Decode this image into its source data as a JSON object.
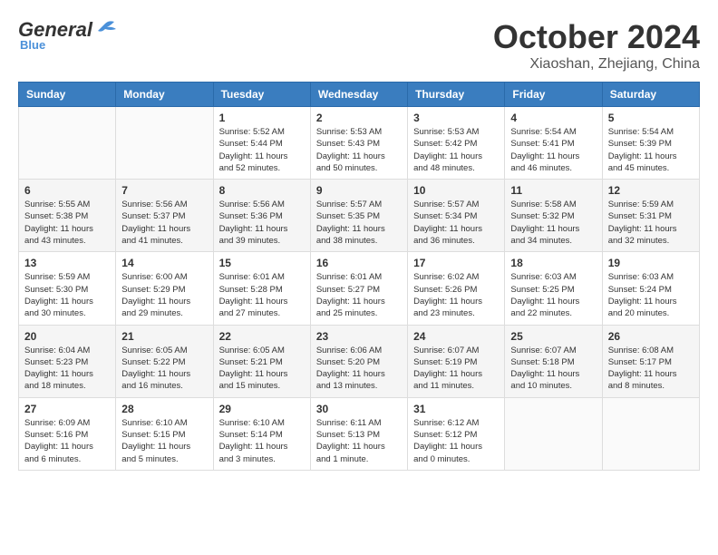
{
  "header": {
    "logo_general": "General",
    "logo_blue": "Blue",
    "month_title": "October 2024",
    "location": "Xiaoshan, Zhejiang, China"
  },
  "columns": [
    "Sunday",
    "Monday",
    "Tuesday",
    "Wednesday",
    "Thursday",
    "Friday",
    "Saturday"
  ],
  "weeks": [
    [
      {
        "day": "",
        "info": ""
      },
      {
        "day": "",
        "info": ""
      },
      {
        "day": "1",
        "info": "Sunrise: 5:52 AM\nSunset: 5:44 PM\nDaylight: 11 hours\nand 52 minutes."
      },
      {
        "day": "2",
        "info": "Sunrise: 5:53 AM\nSunset: 5:43 PM\nDaylight: 11 hours\nand 50 minutes."
      },
      {
        "day": "3",
        "info": "Sunrise: 5:53 AM\nSunset: 5:42 PM\nDaylight: 11 hours\nand 48 minutes."
      },
      {
        "day": "4",
        "info": "Sunrise: 5:54 AM\nSunset: 5:41 PM\nDaylight: 11 hours\nand 46 minutes."
      },
      {
        "day": "5",
        "info": "Sunrise: 5:54 AM\nSunset: 5:39 PM\nDaylight: 11 hours\nand 45 minutes."
      }
    ],
    [
      {
        "day": "6",
        "info": "Sunrise: 5:55 AM\nSunset: 5:38 PM\nDaylight: 11 hours\nand 43 minutes."
      },
      {
        "day": "7",
        "info": "Sunrise: 5:56 AM\nSunset: 5:37 PM\nDaylight: 11 hours\nand 41 minutes."
      },
      {
        "day": "8",
        "info": "Sunrise: 5:56 AM\nSunset: 5:36 PM\nDaylight: 11 hours\nand 39 minutes."
      },
      {
        "day": "9",
        "info": "Sunrise: 5:57 AM\nSunset: 5:35 PM\nDaylight: 11 hours\nand 38 minutes."
      },
      {
        "day": "10",
        "info": "Sunrise: 5:57 AM\nSunset: 5:34 PM\nDaylight: 11 hours\nand 36 minutes."
      },
      {
        "day": "11",
        "info": "Sunrise: 5:58 AM\nSunset: 5:32 PM\nDaylight: 11 hours\nand 34 minutes."
      },
      {
        "day": "12",
        "info": "Sunrise: 5:59 AM\nSunset: 5:31 PM\nDaylight: 11 hours\nand 32 minutes."
      }
    ],
    [
      {
        "day": "13",
        "info": "Sunrise: 5:59 AM\nSunset: 5:30 PM\nDaylight: 11 hours\nand 30 minutes."
      },
      {
        "day": "14",
        "info": "Sunrise: 6:00 AM\nSunset: 5:29 PM\nDaylight: 11 hours\nand 29 minutes."
      },
      {
        "day": "15",
        "info": "Sunrise: 6:01 AM\nSunset: 5:28 PM\nDaylight: 11 hours\nand 27 minutes."
      },
      {
        "day": "16",
        "info": "Sunrise: 6:01 AM\nSunset: 5:27 PM\nDaylight: 11 hours\nand 25 minutes."
      },
      {
        "day": "17",
        "info": "Sunrise: 6:02 AM\nSunset: 5:26 PM\nDaylight: 11 hours\nand 23 minutes."
      },
      {
        "day": "18",
        "info": "Sunrise: 6:03 AM\nSunset: 5:25 PM\nDaylight: 11 hours\nand 22 minutes."
      },
      {
        "day": "19",
        "info": "Sunrise: 6:03 AM\nSunset: 5:24 PM\nDaylight: 11 hours\nand 20 minutes."
      }
    ],
    [
      {
        "day": "20",
        "info": "Sunrise: 6:04 AM\nSunset: 5:23 PM\nDaylight: 11 hours\nand 18 minutes."
      },
      {
        "day": "21",
        "info": "Sunrise: 6:05 AM\nSunset: 5:22 PM\nDaylight: 11 hours\nand 16 minutes."
      },
      {
        "day": "22",
        "info": "Sunrise: 6:05 AM\nSunset: 5:21 PM\nDaylight: 11 hours\nand 15 minutes."
      },
      {
        "day": "23",
        "info": "Sunrise: 6:06 AM\nSunset: 5:20 PM\nDaylight: 11 hours\nand 13 minutes."
      },
      {
        "day": "24",
        "info": "Sunrise: 6:07 AM\nSunset: 5:19 PM\nDaylight: 11 hours\nand 11 minutes."
      },
      {
        "day": "25",
        "info": "Sunrise: 6:07 AM\nSunset: 5:18 PM\nDaylight: 11 hours\nand 10 minutes."
      },
      {
        "day": "26",
        "info": "Sunrise: 6:08 AM\nSunset: 5:17 PM\nDaylight: 11 hours\nand 8 minutes."
      }
    ],
    [
      {
        "day": "27",
        "info": "Sunrise: 6:09 AM\nSunset: 5:16 PM\nDaylight: 11 hours\nand 6 minutes."
      },
      {
        "day": "28",
        "info": "Sunrise: 6:10 AM\nSunset: 5:15 PM\nDaylight: 11 hours\nand 5 minutes."
      },
      {
        "day": "29",
        "info": "Sunrise: 6:10 AM\nSunset: 5:14 PM\nDaylight: 11 hours\nand 3 minutes."
      },
      {
        "day": "30",
        "info": "Sunrise: 6:11 AM\nSunset: 5:13 PM\nDaylight: 11 hours\nand 1 minute."
      },
      {
        "day": "31",
        "info": "Sunrise: 6:12 AM\nSunset: 5:12 PM\nDaylight: 11 hours\nand 0 minutes."
      },
      {
        "day": "",
        "info": ""
      },
      {
        "day": "",
        "info": ""
      }
    ]
  ]
}
